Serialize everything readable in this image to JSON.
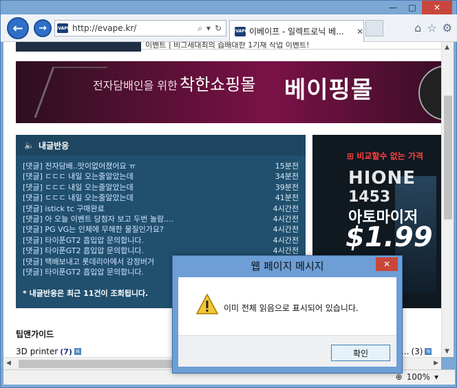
{
  "browser": {
    "url": "http://evape.kr/",
    "favicon_text": "EVAPE",
    "tab_title": "이베이프 - 일렉트로닉 베...",
    "zoom": "100%"
  },
  "page": {
    "top_notice": "이벤트 | 비그세대최의 즙배대한 1기재 작업 이벤트!",
    "banner": {
      "subtitle": "전자담배인을 위한",
      "title": "착한쇼핑몰",
      "brand": "베이핑몰"
    },
    "comments": {
      "heading": "내글반응",
      "items": [
        {
          "text": "[댓글] 전자담배..맛이없어졌어요 ㅠ",
          "time": "15분전"
        },
        {
          "text": "[댓글] ㄷㄷㄷ 내일 오는줄알았는데",
          "time": "34분전"
        },
        {
          "text": "[댓글] ㄷㄷㄷ 내일 오는줄알았는데",
          "time": "39분전"
        },
        {
          "text": "[댓글] ㄷㄷㄷ 내일 오는줄알았는데",
          "time": "41분전"
        },
        {
          "text": "[댓글] istick tc 구매완료",
          "time": "4시간전"
        },
        {
          "text": "[댓글] 아 오늘 이벤트 당첨자 보고 두번 놀람....",
          "time": "4시간전"
        },
        {
          "text": "[댓글] PG VG는 인체에 무해한 물질인가요?",
          "time": "4시간전"
        },
        {
          "text": "[댓글] 타이푼GT2 흡입압 문의합니다.",
          "time": "4시간전"
        },
        {
          "text": "[댓글] 타이푼GT2 흡입압 문의합니다.",
          "time": "4시간전"
        },
        {
          "text": "[댓글] 택배보내고 롯데리아에서 강정버거",
          "time": ""
        },
        {
          "text": "[댓글] 타이푼GT2 흡입압 문의합니다.",
          "time": ""
        }
      ],
      "footer": "* 내글반응은 최근 11건이 조회됩니다."
    },
    "ad": {
      "tag": "비교할수 없는 가격",
      "line1": "HIONE",
      "line2": "1453",
      "line3": "아토마이저",
      "price": "$1.99"
    },
    "tips": {
      "title": "팁앤가이드",
      "item1_label": "3D printer",
      "item1_count": "(7)",
      "item2_label": "...",
      "item2_count": "(3)",
      "new_badge": "N"
    }
  },
  "dialog": {
    "title": "웹 페이지 메시지",
    "message": "이미 전체 읽음으로 표시되어 있습니다.",
    "ok_label": "확인",
    "close_label": "✕"
  }
}
